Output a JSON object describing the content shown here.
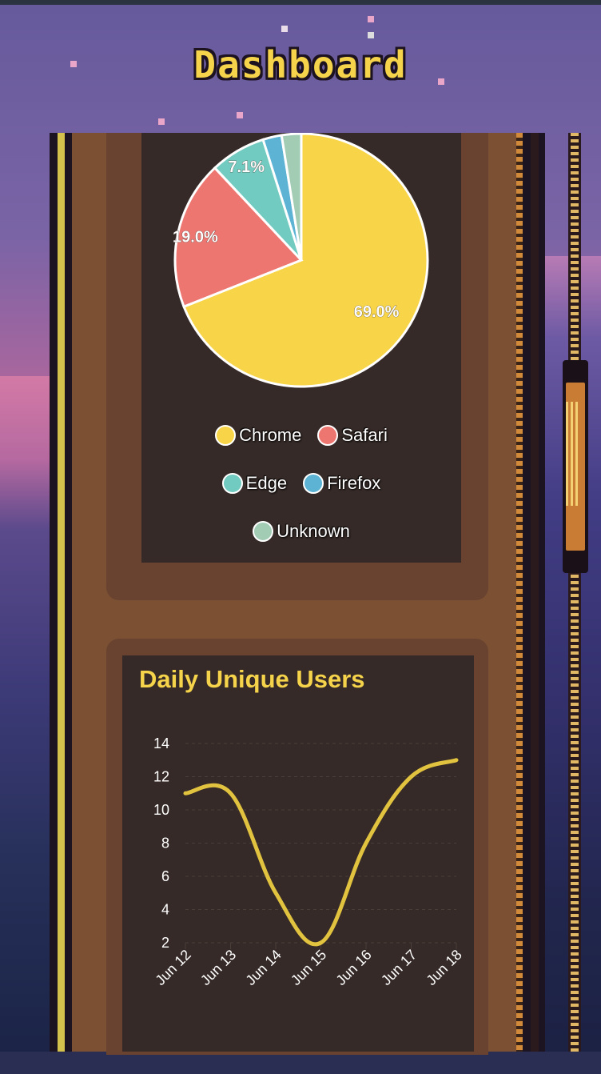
{
  "page": {
    "title": "Dashboard"
  },
  "browser_pie": {
    "legend": [
      {
        "label": "Chrome",
        "color": "#f8d548"
      },
      {
        "label": "Safari",
        "color": "#ee7671"
      },
      {
        "label": "Edge",
        "color": "#72cbc0"
      },
      {
        "label": "Firefox",
        "color": "#5cb3d4"
      },
      {
        "label": "Unknown",
        "color": "#a3ccb5"
      }
    ]
  },
  "daily_users": {
    "title": "Daily Unique Users"
  },
  "chart_data": [
    {
      "type": "pie",
      "categories": [
        "Chrome",
        "Safari",
        "Edge",
        "Firefox",
        "Unknown"
      ],
      "values": [
        69.0,
        19.0,
        7.1,
        2.4,
        2.5
      ],
      "labels": [
        "69.0%",
        "19.0%",
        "7.1%",
        "",
        ""
      ],
      "colors": [
        "#f8d548",
        "#ee7671",
        "#72cbc0",
        "#5cb3d4",
        "#a3ccb5"
      ],
      "legend": "bottom"
    },
    {
      "type": "line",
      "title": "Daily Unique Users",
      "categories": [
        "Jun 12",
        "Jun 13",
        "Jun 14",
        "Jun 15",
        "Jun 16",
        "Jun 17",
        "Jun 18"
      ],
      "series": [
        {
          "values": [
            11,
            11,
            5,
            2,
            8,
            12,
            13
          ],
          "color": "#e2c33f"
        }
      ],
      "yticks": [
        2,
        4,
        6,
        8,
        10,
        12,
        14
      ],
      "ylim": [
        2,
        14
      ],
      "grid": true
    }
  ]
}
